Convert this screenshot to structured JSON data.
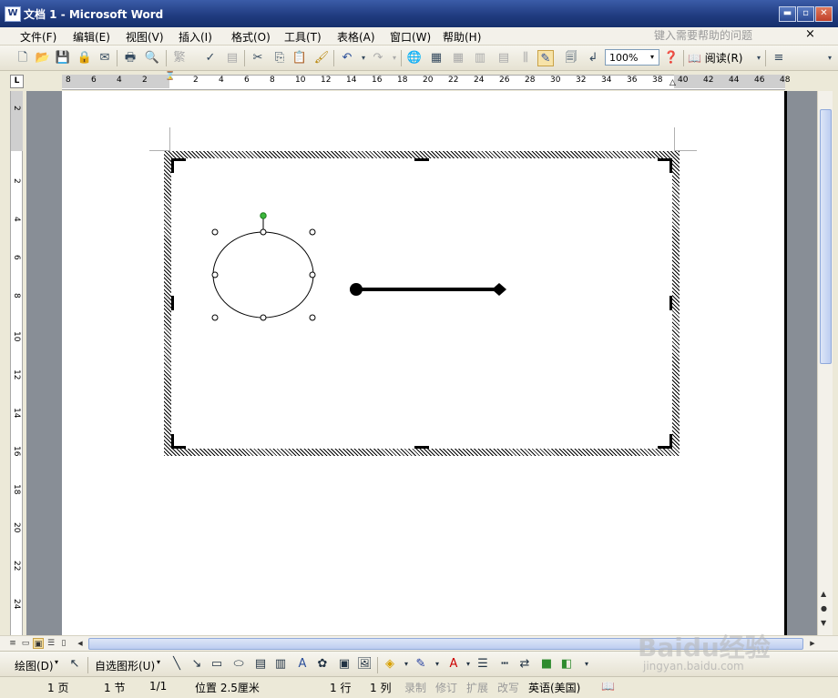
{
  "window": {
    "title": "文档 1 - Microsoft Word",
    "app_icon_letter": "W",
    "minimize_glyph": "▬",
    "restore_glyph": "▫",
    "close_glyph": "✕"
  },
  "menubar": {
    "items": [
      "文件(F)",
      "编辑(E)",
      "视图(V)",
      "插入(I)",
      "格式(O)",
      "工具(T)",
      "表格(A)",
      "窗口(W)",
      "帮助(H)"
    ],
    "help_placeholder": "键入需要帮助的问题",
    "help_close": "×"
  },
  "toolbar": {
    "zoom_value": "100%",
    "read_label": "阅读(R)",
    "dropdown_glyph": "▾"
  },
  "ruler": {
    "tab_selector_glyph": "L",
    "horizontal_labels": [
      "8",
      "6",
      "4",
      "2",
      "2",
      "4",
      "6",
      "8",
      "10",
      "12",
      "14",
      "16",
      "18",
      "20",
      "22",
      "24",
      "26",
      "28",
      "30",
      "32",
      "34",
      "36",
      "38",
      "40",
      "42",
      "44",
      "46",
      "48"
    ],
    "vertical_labels": [
      "2",
      "2",
      "4",
      "6",
      "8",
      "10",
      "12",
      "14",
      "16",
      "18",
      "20",
      "22",
      "24"
    ]
  },
  "drawing_toolbar": {
    "draw_label": "绘图(D)",
    "autoshapes_label": "自选图形(U)"
  },
  "statusbar": {
    "page": "1 页",
    "section": "1 节",
    "page_of": "1/1",
    "position": "位置 2.5厘米",
    "line": "1 行",
    "column": "1 列",
    "rec": "录制",
    "trk": "修订",
    "ext": "扩展",
    "ovr": "改写",
    "language": "英语(美国)"
  },
  "watermark": {
    "brand": "Baidu经验",
    "url": "jingyan.baidu.com"
  },
  "colors": {
    "titlebar": "#1f3a7e",
    "canvas_hatch": "#000000",
    "selection_handle": "#ffffff",
    "rotation_handle": "#3cb83c",
    "line_shape": "#000000"
  }
}
